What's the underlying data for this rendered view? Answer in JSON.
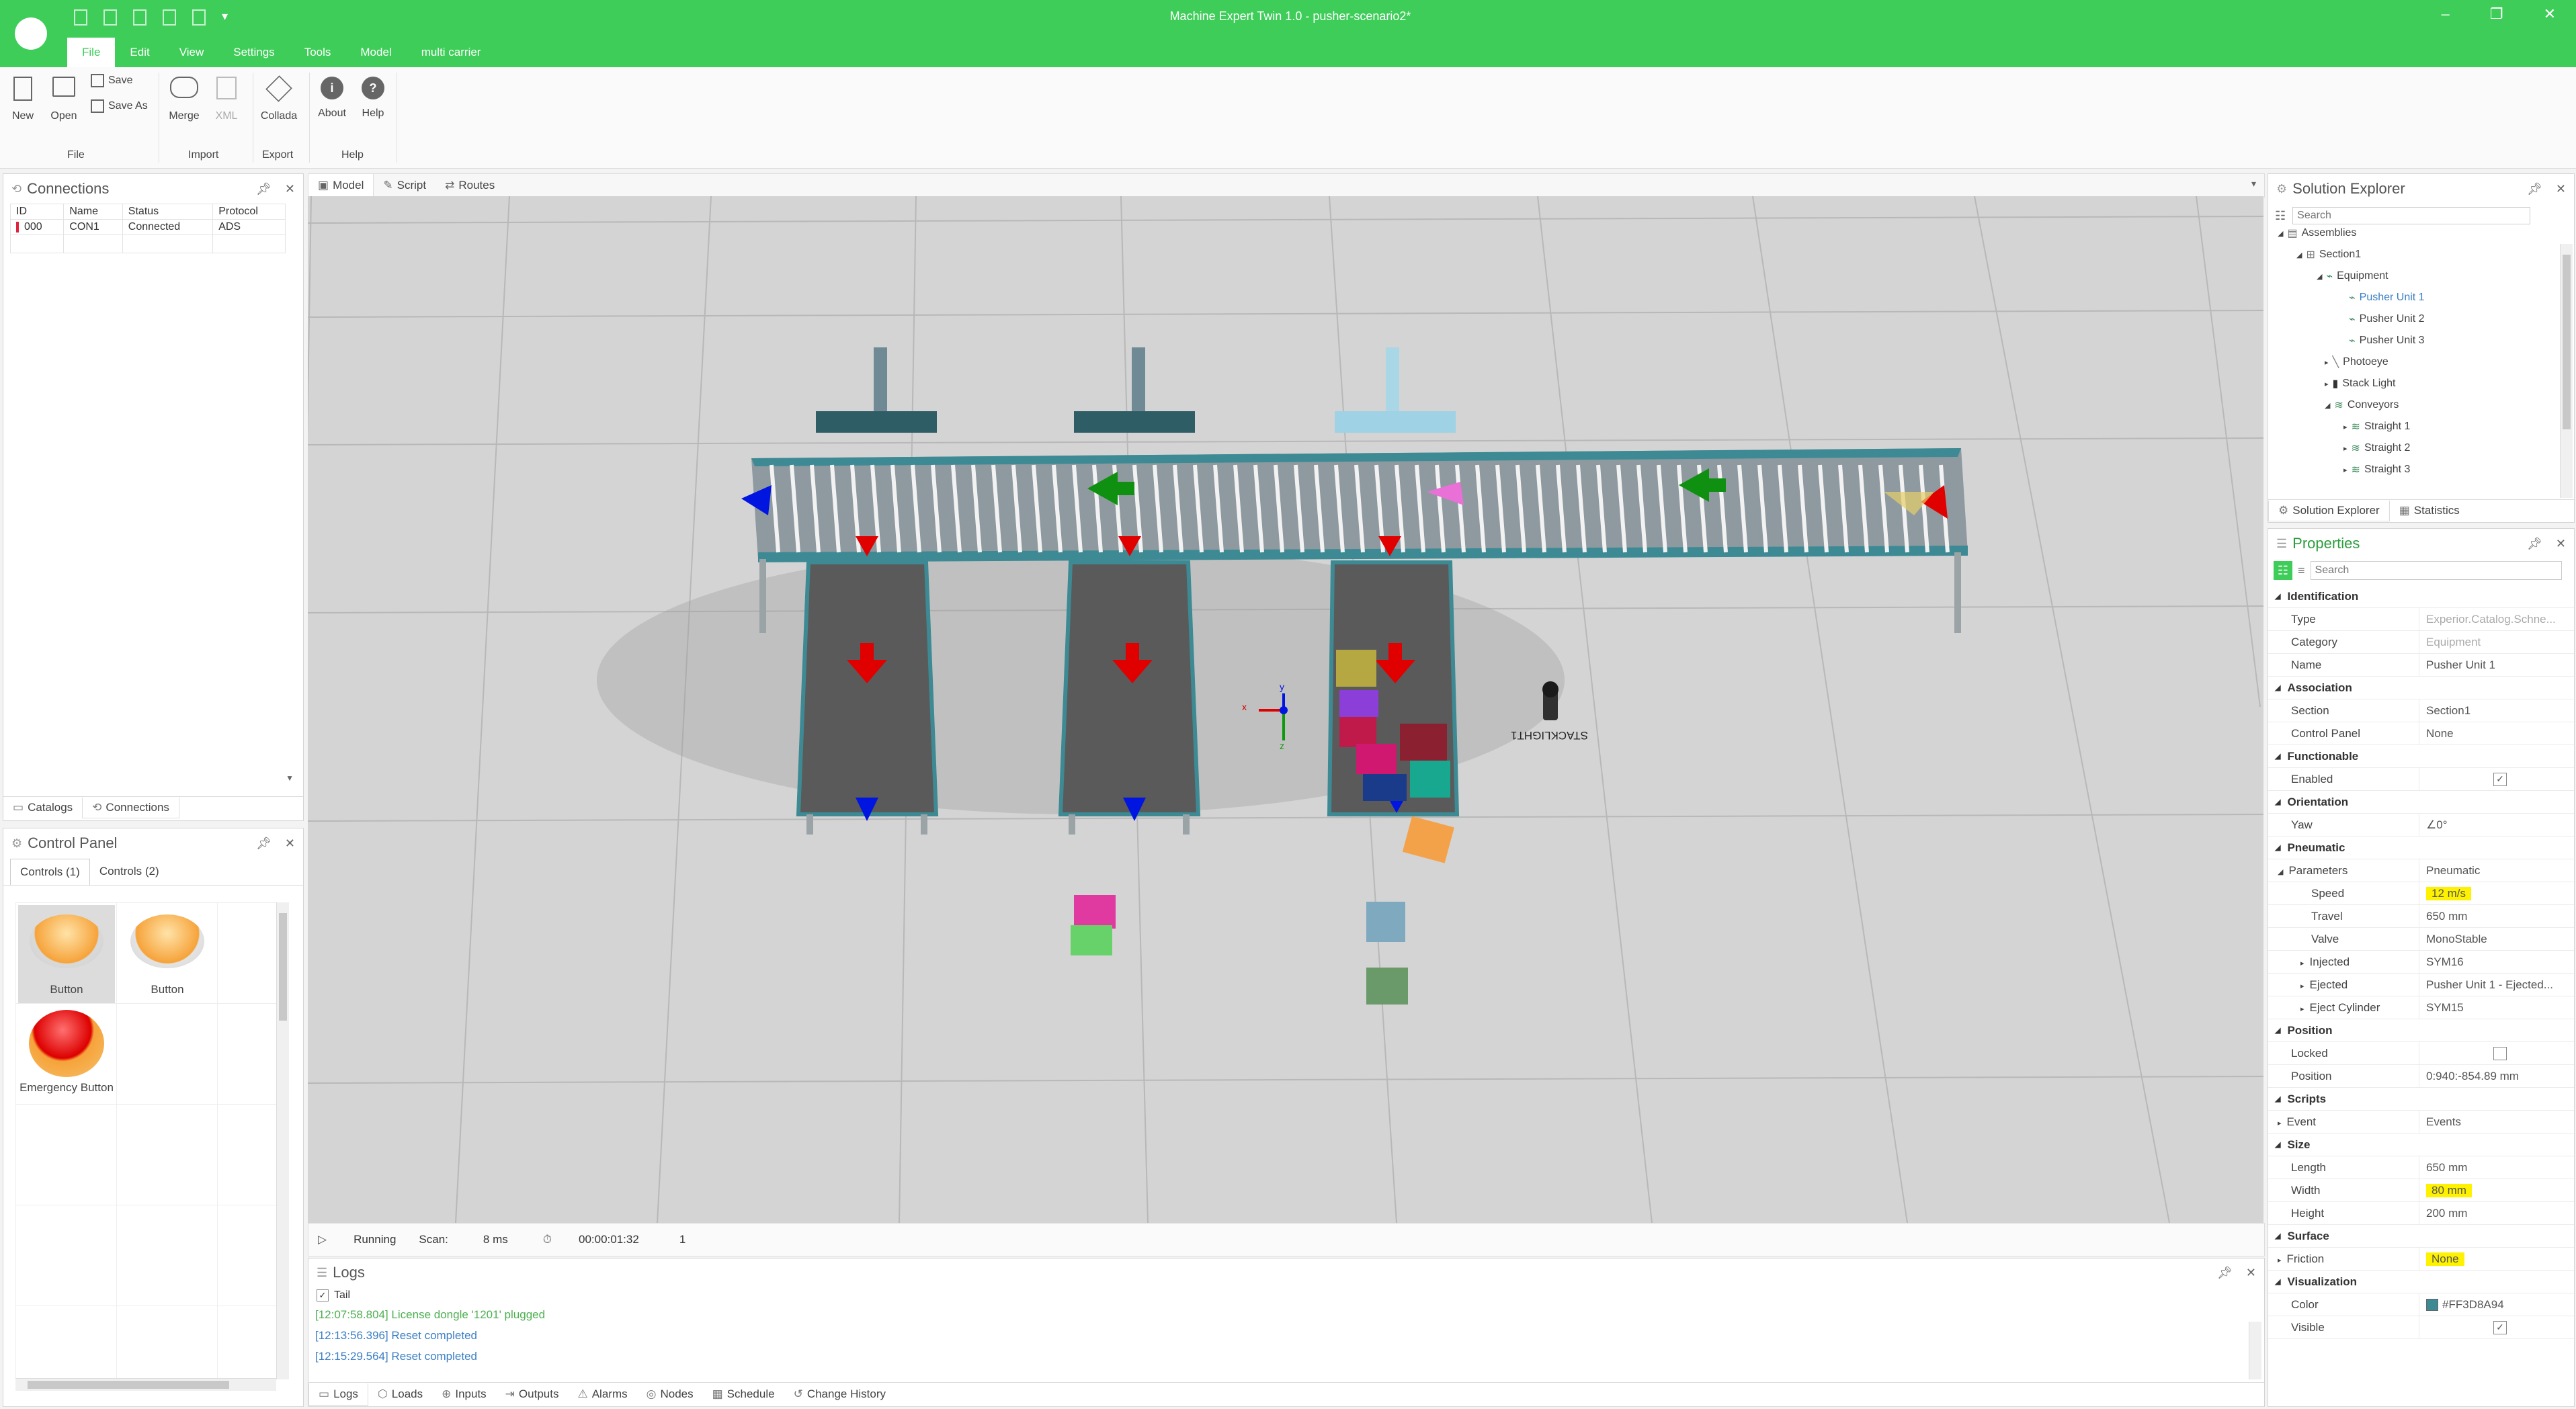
{
  "window": {
    "title": "Machine Expert Twin 1.0 - pusher-scenario2*"
  },
  "menu": [
    "File",
    "Edit",
    "View",
    "Settings",
    "Tools",
    "Model",
    "multi carrier"
  ],
  "ribbon": {
    "groups": [
      {
        "label": "File",
        "items": [
          "New",
          "Open",
          "Save",
          "Save As"
        ]
      },
      {
        "label": "Import",
        "items": [
          "Merge",
          "XML"
        ]
      },
      {
        "label": "Export",
        "items": [
          "Collada"
        ]
      },
      {
        "label": "Help",
        "items": [
          "About",
          "Help"
        ]
      }
    ]
  },
  "connections": {
    "title": "Connections",
    "columns": [
      "ID",
      "Name",
      "Status",
      "Protocol"
    ],
    "rows": [
      {
        "id": "000",
        "name": "CON1",
        "status": "Connected",
        "protocol": "ADS"
      }
    ],
    "tabs": [
      "Catalogs",
      "Connections"
    ]
  },
  "control_panel": {
    "title": "Control Panel",
    "tabs": [
      "Controls (1)",
      "Controls (2)"
    ],
    "buttons": [
      "Button",
      "Button",
      "Emergency Button"
    ]
  },
  "viewport": {
    "tabs": [
      "Model",
      "Script",
      "Routes"
    ],
    "label_stacklight": "STACKLIGHT1",
    "axis": {
      "x": "x",
      "y": "y",
      "z": "z"
    },
    "status": {
      "state": "Running",
      "scan_label": "Scan:",
      "scan_value": "8 ms",
      "time": "00:00:01:32",
      "count": "1"
    }
  },
  "logs": {
    "title": "Logs",
    "tail_label": "Tail",
    "lines": [
      {
        "text": "[12:07:58.804] License dongle '1201' plugged",
        "color": "#4caf50"
      },
      {
        "text": "[12:13:56.396] Reset completed",
        "color": "#3b7fc4"
      },
      {
        "text": "[12:15:29.564] Reset completed",
        "color": "#3b7fc4"
      }
    ],
    "tabs": [
      "Logs",
      "Loads",
      "Inputs",
      "Outputs",
      "Alarms",
      "Nodes",
      "Schedule",
      "Change History"
    ]
  },
  "solution_explorer": {
    "title": "Solution Explorer",
    "search_placeholder": "Search",
    "tree": [
      {
        "label": "Assemblies",
        "level": 0
      },
      {
        "label": "Section1",
        "level": 1
      },
      {
        "label": "Equipment",
        "level": 2
      },
      {
        "label": "Pusher Unit 1",
        "level": 3,
        "selected": true
      },
      {
        "label": "Pusher Unit 2",
        "level": 3
      },
      {
        "label": "Pusher Unit 3",
        "level": 3
      },
      {
        "label": "Photoeye",
        "level": 2
      },
      {
        "label": "Stack Light",
        "level": 2
      },
      {
        "label": "Conveyors",
        "level": 2
      },
      {
        "label": "Straight 1",
        "level": 3
      },
      {
        "label": "Straight 2",
        "level": 3
      },
      {
        "label": "Straight 3",
        "level": 3
      }
    ],
    "tabs": [
      "Solution Explorer",
      "Statistics"
    ]
  },
  "properties": {
    "title": "Properties",
    "search_placeholder": "Search",
    "sections": [
      {
        "name": "Identification",
        "rows": [
          {
            "k": "Type",
            "v": "Experior.Catalog.Schne..."
          },
          {
            "k": "Category",
            "v": "Equipment"
          },
          {
            "k": "Name",
            "v": "Pusher Unit 1"
          }
        ]
      },
      {
        "name": "Association",
        "rows": [
          {
            "k": "Section",
            "v": "Section1"
          },
          {
            "k": "Control Panel",
            "v": "None"
          }
        ]
      },
      {
        "name": "Functionable",
        "rows": [
          {
            "k": "Enabled",
            "v": "✓",
            "checkbox": true
          }
        ]
      },
      {
        "name": "Orientation",
        "rows": [
          {
            "k": "Yaw",
            "v": "∠0°"
          }
        ]
      },
      {
        "name": "Pneumatic",
        "rows": [
          {
            "k": "Parameters",
            "v": "Pneumatic"
          },
          {
            "k": "Speed",
            "v": "12 m/s",
            "highlight": true,
            "indent": 1
          },
          {
            "k": "Travel",
            "v": "650 mm",
            "indent": 1
          },
          {
            "k": "Valve",
            "v": "MonoStable",
            "indent": 1
          },
          {
            "k": "Injected",
            "v": "SYM16",
            "indent": 1
          },
          {
            "k": "Ejected",
            "v": "Pusher Unit 1 - Ejected...",
            "indent": 1
          },
          {
            "k": "Eject Cylinder",
            "v": "SYM15",
            "indent": 1
          }
        ]
      },
      {
        "name": "Position",
        "rows": [
          {
            "k": "Locked",
            "v": "",
            "checkbox": true
          },
          {
            "k": "Position",
            "v": "0:940:-854.89 mm"
          }
        ]
      },
      {
        "name": "Scripts",
        "rows": [
          {
            "k": "Event",
            "v": "Events"
          }
        ]
      },
      {
        "name": "Size",
        "rows": [
          {
            "k": "Length",
            "v": "650 mm"
          },
          {
            "k": "Width",
            "v": "80 mm",
            "highlight": true
          },
          {
            "k": "Height",
            "v": "200 mm"
          }
        ]
      },
      {
        "name": "Surface",
        "rows": [
          {
            "k": "Friction",
            "v": "None",
            "highlight": true
          }
        ]
      },
      {
        "name": "Visualization",
        "rows": [
          {
            "k": "Color",
            "v": "#FF3D8A94",
            "swatch": "#3d8a94"
          },
          {
            "k": "Visible",
            "v": "✓",
            "checkbox": true
          }
        ]
      }
    ]
  },
  "colors": {
    "brand": "#3dcd58",
    "highlight": "#fff200"
  }
}
